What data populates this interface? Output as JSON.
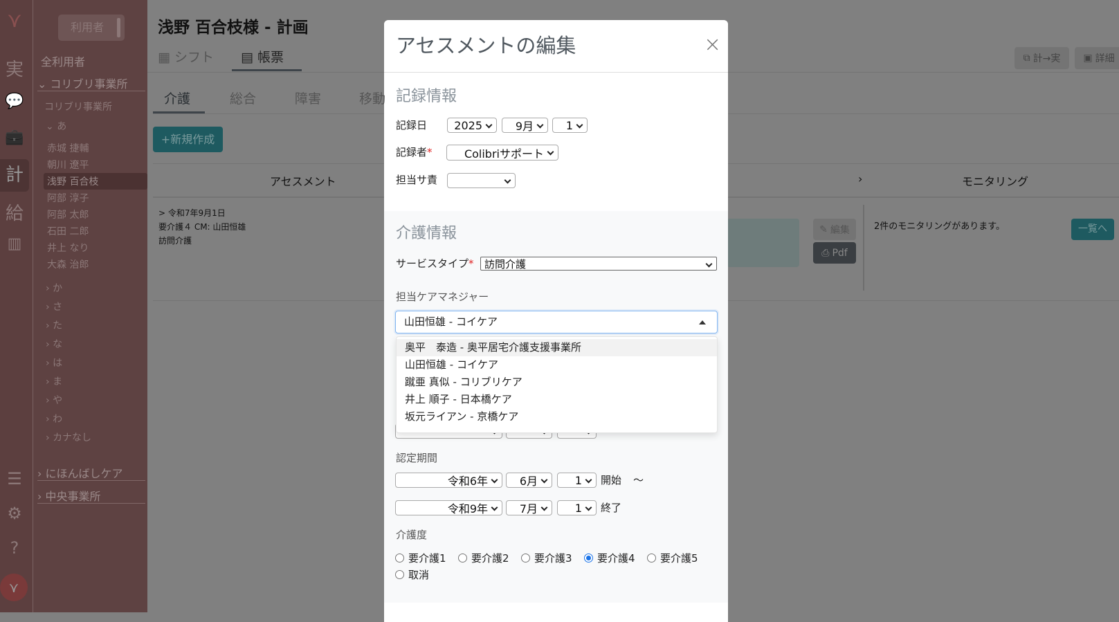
{
  "iconbar": {
    "items": [
      "実",
      "計",
      "給"
    ]
  },
  "sidebar": {
    "user_button": "利用者",
    "all_users": "全利用者",
    "office1": "コリブリ事業所",
    "office1_sub": "コリブリ事業所",
    "group_a": "あ",
    "users": [
      "赤城 捷輔",
      "朝川 遼平",
      "浅野 百合枝",
      "阿部 淳子",
      "阿部 太郎",
      "石田 二郎",
      "井上 なり",
      "大森 治郎"
    ],
    "selected_user_index": 2,
    "groups": [
      "か",
      "さ",
      "た",
      "な",
      "は",
      "ま",
      "や",
      "わ",
      "カナなし"
    ],
    "office2": "にほんばしケア",
    "office3": "中央事業所"
  },
  "main": {
    "title": "浅野 百合枝様 - 計画",
    "tabs": [
      "シフト",
      "帳票"
    ],
    "top_buttons": [
      "計→実",
      "詳細"
    ],
    "subtabs": [
      "介護",
      "総合",
      "障害",
      "移動"
    ],
    "new_button": "+新規作成",
    "col_assessment": "アセスメント",
    "col_arrow": "›",
    "col_monitoring": "モニタリング",
    "record": {
      "date": "> 令和7年9月1日",
      "line2": "要介護４ CM: 山田恒雄",
      "line3": "訪問介護"
    },
    "edit_button": "編集",
    "pdf_button": "Pdf",
    "monitoring_text": "2件のモニタリングがあります。",
    "list_button": "一覧へ"
  },
  "modal": {
    "title": "アセスメントの編集",
    "close": "×",
    "section1": "記録情報",
    "record_date_label": "記録日",
    "record_year": "2025",
    "record_month": "9月",
    "record_day": "1",
    "recorder_label": "記録者",
    "required": "*",
    "recorder_value": "Colibriサポート",
    "staff_label": "担当サ責",
    "staff_value": "",
    "section2": "介護情報",
    "service_label": "サービスタイプ",
    "service_value": "訪問介護",
    "cm_label": "担当ケアマネジャー",
    "cm_value": "山田恒雄 - コイケア",
    "cm_options": [
      "奥平　泰造 - 奥平居宅介護支援事業所",
      "山田恒雄 - コイケア",
      "蹴亜 真似 - コリブリケア",
      "井上 順子 - 日本橋ケア",
      "坂元ライアン - 京橋ケア"
    ],
    "period_label": "認定期間",
    "start": {
      "year": "令和6年",
      "month": "6月",
      "day": "1",
      "suffix": "開始",
      "tilde": "〜"
    },
    "end": {
      "year": "令和9年",
      "month": "7月",
      "day": "1",
      "suffix": "終了"
    },
    "level_label": "介護度",
    "levels": [
      "要介護1",
      "要介護2",
      "要介護3",
      "要介護4",
      "要介護5",
      "取消"
    ],
    "selected_level": "要介護4"
  }
}
